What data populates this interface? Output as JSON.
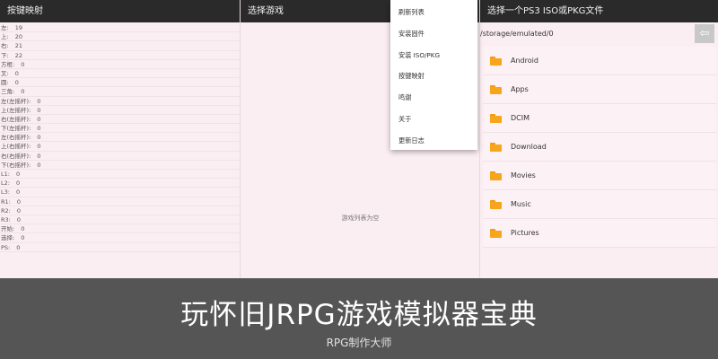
{
  "panel1": {
    "title": "按键映射",
    "mappings": [
      {
        "key": "左:",
        "value": "19"
      },
      {
        "key": "上:",
        "value": "20"
      },
      {
        "key": "右:",
        "value": "21"
      },
      {
        "key": "下:",
        "value": "22"
      },
      {
        "key": "方框:",
        "value": "0"
      },
      {
        "key": "叉:",
        "value": "0"
      },
      {
        "key": "圆:",
        "value": "0"
      },
      {
        "key": "三角:",
        "value": "0"
      },
      {
        "key": "左(左摇杆):",
        "value": "0"
      },
      {
        "key": "上(左摇杆):",
        "value": "0"
      },
      {
        "key": "右(左摇杆):",
        "value": "0"
      },
      {
        "key": "下(左摇杆):",
        "value": "0"
      },
      {
        "key": "左(右摇杆):",
        "value": "0"
      },
      {
        "key": "上(右摇杆):",
        "value": "0"
      },
      {
        "key": "右(右摇杆):",
        "value": "0"
      },
      {
        "key": "下(右摇杆):",
        "value": "0"
      },
      {
        "key": "L1:",
        "value": "0"
      },
      {
        "key": "L2:",
        "value": "0"
      },
      {
        "key": "L3:",
        "value": "0"
      },
      {
        "key": "R1:",
        "value": "0"
      },
      {
        "key": "R2:",
        "value": "0"
      },
      {
        "key": "R3:",
        "value": "0"
      },
      {
        "key": "开始:",
        "value": "0"
      },
      {
        "key": "选择:",
        "value": "0"
      },
      {
        "key": "PS:",
        "value": "0"
      }
    ]
  },
  "panel2": {
    "title": "选择游戏",
    "empty_text": "游戏列表为空"
  },
  "menu": {
    "items": [
      "刷新列表",
      "安装固件",
      "安装 ISO/PKG",
      "按键映射",
      "鸣谢",
      "关于",
      "更新日志"
    ]
  },
  "panel3": {
    "title": "选择一个PS3 ISO或PKG文件",
    "path": "/storage/emulated/0",
    "back_icon": "back-arrow-icon",
    "folders": [
      "Android",
      "Apps",
      "DCIM",
      "Download",
      "Movies",
      "Music",
      "Pictures"
    ],
    "folder_color": "#f7a51c"
  },
  "banner": {
    "title": "玩怀旧JRPG游戏模拟器宝典",
    "subtitle": "RPG制作大师"
  }
}
